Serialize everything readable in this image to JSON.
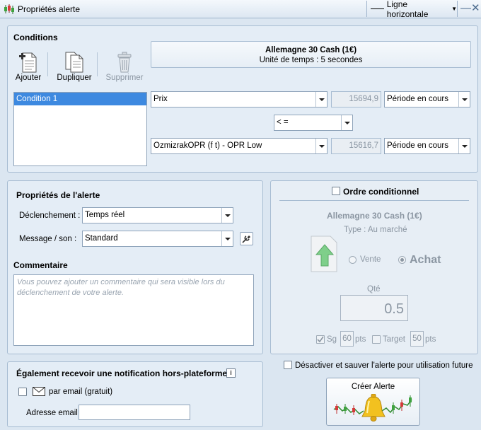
{
  "window": {
    "title": "Propriétés alerte",
    "object_type": "Ligne horizontale"
  },
  "conditions": {
    "title": "Conditions",
    "toolbar": {
      "add": "Ajouter",
      "duplicate": "Dupliquer",
      "delete": "Supprimer"
    },
    "instrument": "Allemagne 30 Cash (1€)",
    "timeframe": "Unité de temps : 5 secondes",
    "list": [
      "Condition 1"
    ],
    "left_operand": "Prix",
    "left_value": "15694,9",
    "left_period": "Période en cours",
    "operator": "< =",
    "right_operand": "OzmizrakOPR (f t) - OPR Low",
    "right_value": "15616,7",
    "right_period": "Période en cours"
  },
  "alert_props": {
    "title": "Propriétés de l'alerte",
    "trigger_label": "Déclenchement :",
    "trigger_value": "Temps réel",
    "message_label": "Message / son :",
    "message_value": "Standard",
    "comment_title": "Commentaire",
    "comment_placeholder": "Vous pouvez ajouter un commentaire qui sera visible lors du déclenchement de votre alerte."
  },
  "order": {
    "title": "Ordre conditionnel",
    "instrument": "Allemagne 30 Cash (1€)",
    "type": "Type : Au marché",
    "sell": "Vente",
    "buy": "Achat",
    "qty_label": "Qté",
    "qty_value": "0.5",
    "sg_label": "Sg",
    "sg_value": "60",
    "target_label": "Target",
    "target_value": "50",
    "pts": "pts"
  },
  "notification": {
    "title": "Également recevoir une notification hors-plateforme",
    "email_option": "par email (gratuit)",
    "email_label": "Adresse email",
    "email_value": ""
  },
  "disable_save": "Désactiver et sauver l'alerte pour utilisation future",
  "create_button": "Créer Alerte",
  "colors": {
    "selection": "#3d89e0",
    "background": "#dbe6f1",
    "panel": "#e4edf6"
  }
}
